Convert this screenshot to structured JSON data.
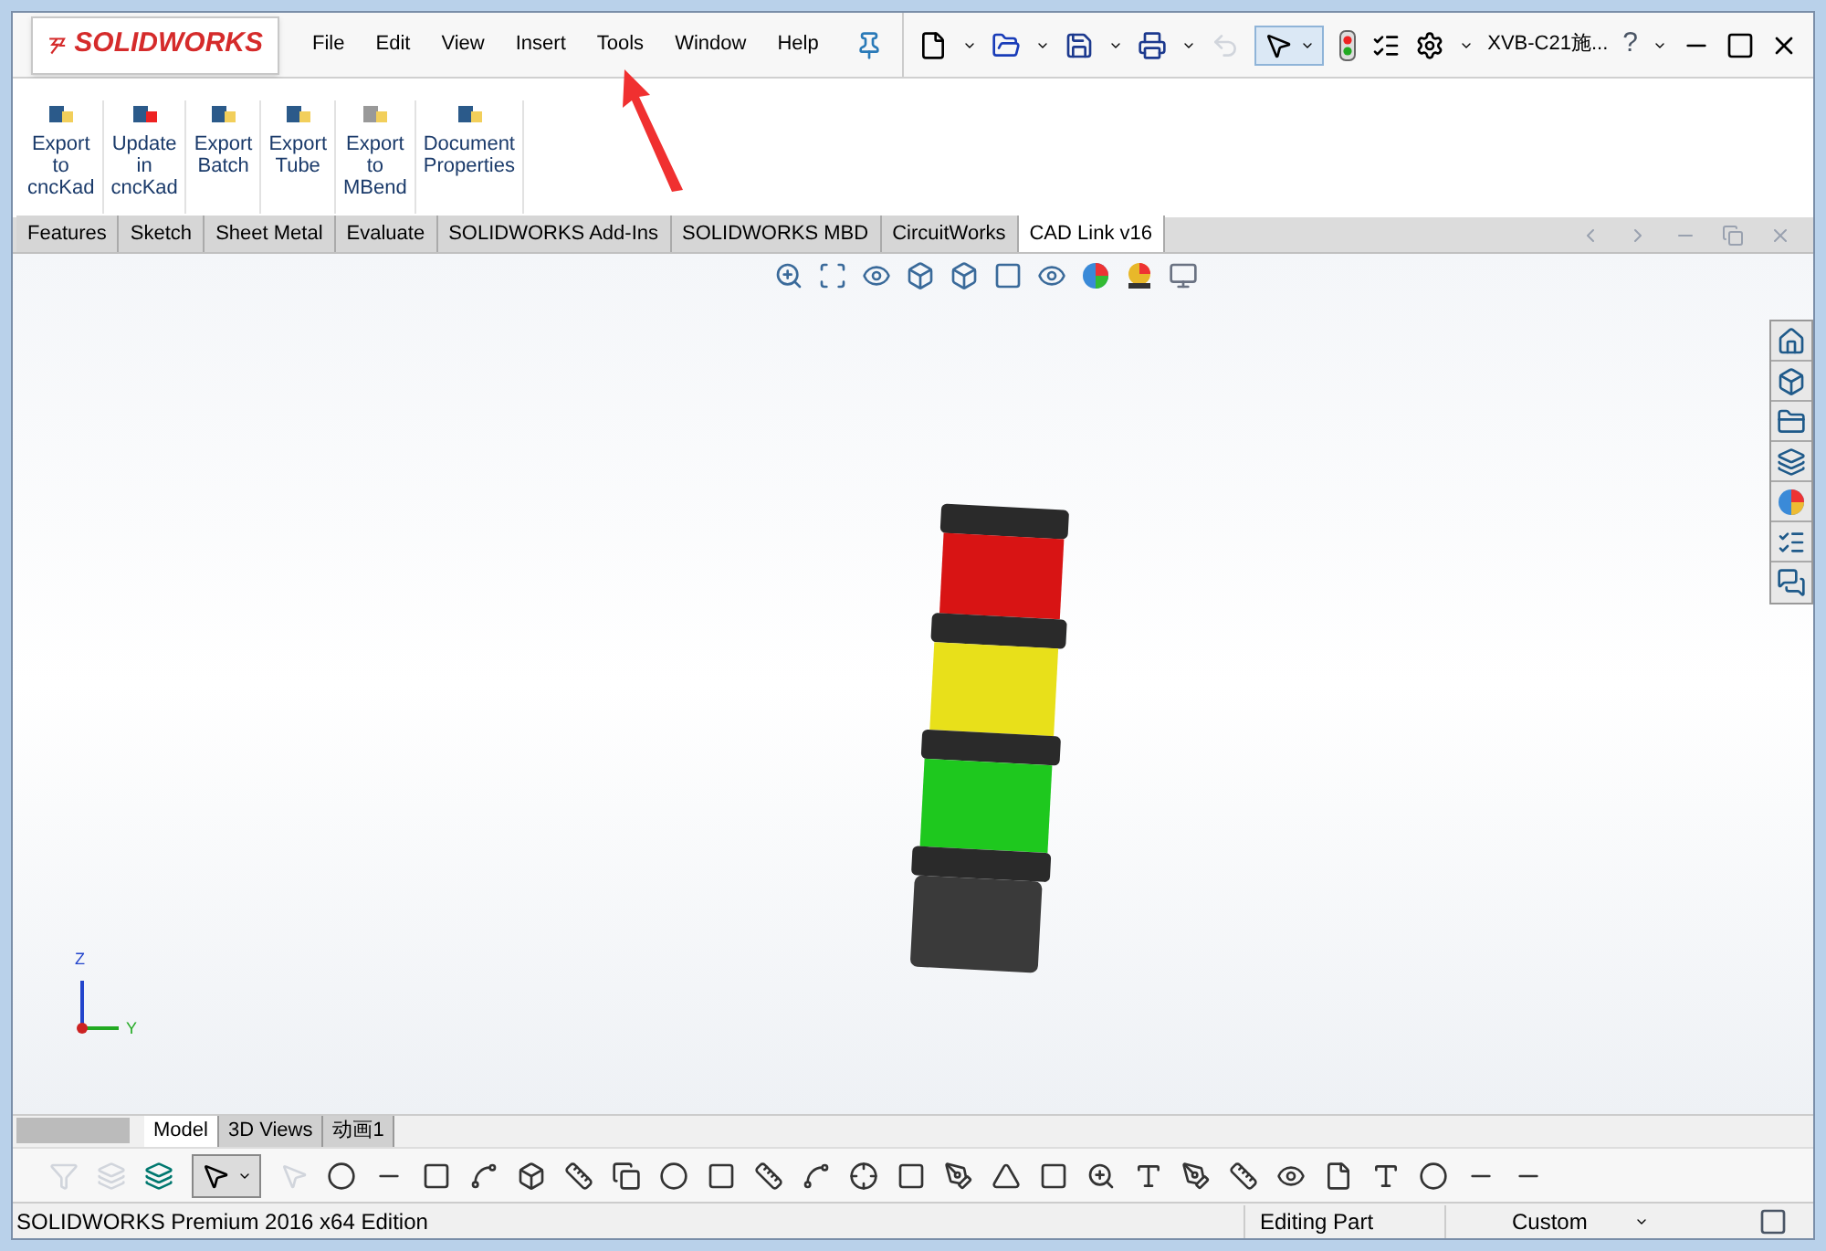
{
  "app": {
    "logo_text": "SOLIDWORKS",
    "document_title": "XVB-C21施...",
    "help": "?"
  },
  "menus": [
    {
      "label": "File"
    },
    {
      "label": "Edit"
    },
    {
      "label": "View"
    },
    {
      "label": "Insert"
    },
    {
      "label": "Tools"
    },
    {
      "label": "Window"
    },
    {
      "label": "Help"
    }
  ],
  "commands": [
    {
      "lines": [
        "Export",
        "to",
        "cncKad"
      ],
      "disabled": false
    },
    {
      "lines": [
        "Update",
        "in",
        "cncKad"
      ],
      "disabled": false
    },
    {
      "lines": [
        "Export",
        "Batch"
      ],
      "disabled": false
    },
    {
      "lines": [
        "Export",
        "Tube"
      ],
      "disabled": false
    },
    {
      "lines": [
        "Export",
        "to",
        "MBend"
      ],
      "disabled": false
    },
    {
      "lines": [
        "Document",
        "Properties"
      ],
      "disabled": false
    }
  ],
  "tabs": [
    {
      "label": "Features",
      "selected": false
    },
    {
      "label": "Sketch",
      "selected": false
    },
    {
      "label": "Sheet Metal",
      "selected": false
    },
    {
      "label": "Evaluate",
      "selected": false
    },
    {
      "label": "SOLIDWORKS Add-Ins",
      "selected": false
    },
    {
      "label": "SOLIDWORKS MBD",
      "selected": false
    },
    {
      "label": "CircuitWorks",
      "selected": false
    },
    {
      "label": "CAD Link v16",
      "selected": true
    }
  ],
  "triad": {
    "z": "Z",
    "y": "Y"
  },
  "bottom_tabs": [
    {
      "label": "Model",
      "selected": true
    },
    {
      "label": "3D Views",
      "selected": false
    },
    {
      "label": "动画1",
      "selected": false
    }
  ],
  "status_bar": {
    "edition": "SOLIDWORKS Premium 2016 x64 Edition",
    "mode": "Editing Part",
    "units": "Custom"
  }
}
